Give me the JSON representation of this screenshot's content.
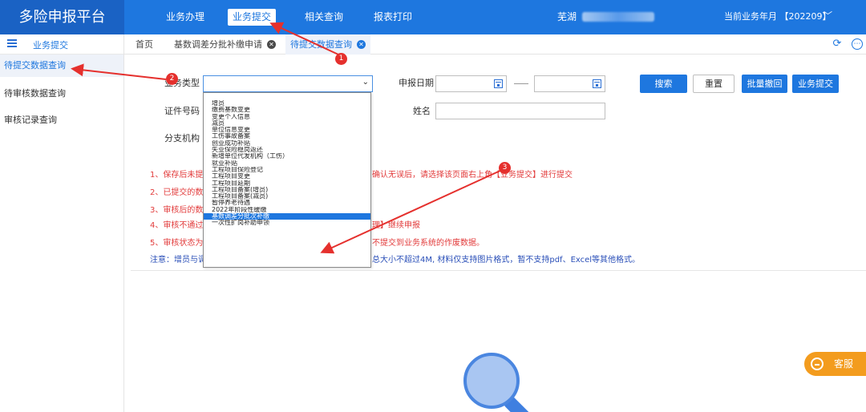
{
  "header": {
    "brand": "多险申报平台",
    "nav": [
      "业务办理",
      "业务提交",
      "相关查询",
      "报表打印"
    ],
    "active_nav": "业务提交",
    "user_name": "芜湖",
    "period_label": "当前业务年月 【202209】",
    "period_chevron": "﹀"
  },
  "sidebar": {
    "title": "业务提交",
    "items": [
      "待提交数据查询",
      "待审核数据查询",
      "审核记录查询"
    ]
  },
  "tabs": {
    "home": "首页",
    "items": [
      "基数调差分批补缴申请",
      "待提交数据查询"
    ],
    "close_glyph": "✕",
    "refresh_glyph": "⟳",
    "more_glyph": "⋯"
  },
  "form": {
    "business_type_label": "业务类型",
    "declare_date_label": "申报日期",
    "id_number_label": "证件号码",
    "name_label": "姓名",
    "branch_label": "分支机构",
    "select_chevron": "⌄",
    "buttons": {
      "search": "搜索",
      "reset": "重置",
      "batch_withdraw": "批量撤回",
      "submit": "业务提交"
    }
  },
  "dropdown": {
    "options": [
      "增员",
      "缴费基数变更",
      "变更个人信息",
      "减员",
      "单位信息变更",
      "工伤事故备案",
      "创业成功补贴",
      "失业保险稳岗返还",
      "新增单位代发机构（工伤）",
      "就业补贴",
      "工程项目保险登记",
      "工程项目变更",
      "工程项目延期",
      "工程项目备案(增员)",
      "工程项目备案(减员)",
      "暂停养老待遇",
      "2022年阶段性缓缴",
      "基数调差分批次补缴",
      "一次性扩岗补助申领"
    ],
    "selected": "基数调差分批次补缴"
  },
  "notes": [
    {
      "head": "1、保存后未提",
      "tail": "确认无误后，请选择该页面右上角【业务提交】进行提交"
    },
    {
      "head": "2、已提交的数",
      "tail": ""
    },
    {
      "head": "3、审核后的数",
      "tail": ""
    },
    {
      "head": "4、审核不通过",
      "tail": "理】继续申报"
    },
    {
      "head": "5、审核状态为",
      "tail": "不提交到业务系统的作废数据。"
    },
    {
      "head": "注意：增员与调",
      "tail": "总大小不超过4M, 材料仅支持图片格式，暂不支持pdf、Excel等其他格式。"
    }
  ],
  "annotations": {
    "badges": [
      "1",
      "2",
      "3"
    ],
    "color": "#e5302d"
  },
  "service": {
    "label": "客服"
  },
  "colors": {
    "primary": "#1e77df",
    "warning_text": "#e23b3b",
    "note_blue": "#2a4fb8",
    "service_orange": "#f39c1e"
  }
}
